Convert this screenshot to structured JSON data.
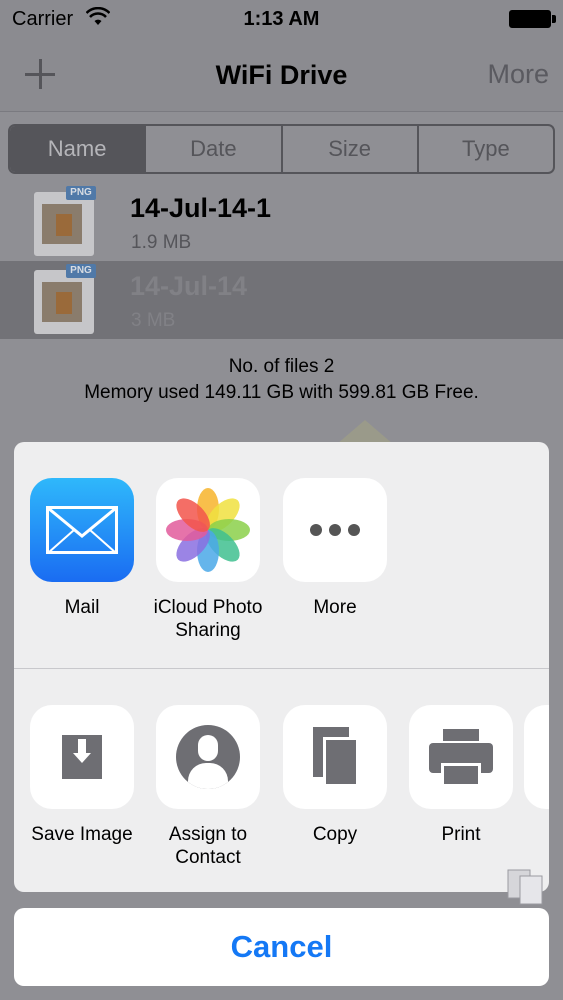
{
  "status_bar": {
    "carrier": "Carrier",
    "time": "1:13 AM"
  },
  "nav": {
    "title": "WiFi Drive",
    "more_label": "More"
  },
  "sort_tabs": [
    {
      "label": "Name",
      "active": true
    },
    {
      "label": "Date",
      "active": false
    },
    {
      "label": "Size",
      "active": false
    },
    {
      "label": "Type",
      "active": false
    }
  ],
  "files": [
    {
      "name": "14-Jul-14-1",
      "size": "1.9 MB",
      "badge": "PNG"
    },
    {
      "name": "14-Jul-14",
      "size": "3 MB",
      "badge": "PNG"
    }
  ],
  "summary": {
    "count_text": "No. of files 2",
    "memory_text": "Memory used 149.11 GB with 599.81 GB Free."
  },
  "share_apps": [
    {
      "label": "Mail",
      "icon": "mail-icon"
    },
    {
      "label": "iCloud Photo Sharing",
      "icon": "photos-icon"
    },
    {
      "label": "More",
      "icon": "more-dots-icon"
    }
  ],
  "share_actions": [
    {
      "label": "Save Image",
      "icon": "save-image-icon"
    },
    {
      "label": "Assign to Contact",
      "icon": "contact-icon"
    },
    {
      "label": "Copy",
      "icon": "copy-icon"
    },
    {
      "label": "Print",
      "icon": "print-icon"
    }
  ],
  "cancel_label": "Cancel",
  "colors": {
    "accent": "#1478f5",
    "sheet_bg": "#eeeeef"
  }
}
